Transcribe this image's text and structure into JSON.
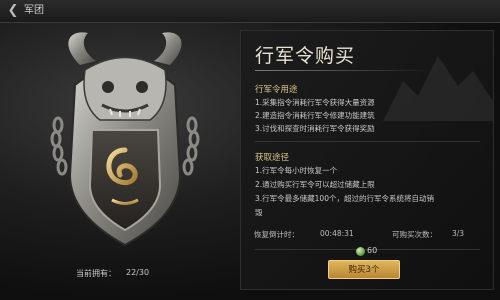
{
  "topbar": {
    "back_icon": "back-arrow-icon",
    "title": "军团"
  },
  "emblem": {
    "icon": "war-token-emblem",
    "held_label": "当前拥有：",
    "held_value": "22/30"
  },
  "panel": {
    "title": "行军令购买",
    "usage": {
      "heading": "行军令用途",
      "lines": [
        "1.采集指令消耗行军令获得大量资源",
        "2.建造指令消耗行军令修建功能建筑",
        "3.讨伐和探查时消耗行军令获得奖励"
      ]
    },
    "obtain": {
      "heading": "获取途径",
      "lines": [
        "1.行军令每小时恢复一个",
        "2.通过购买行军令可以超过储藏上限",
        "3.行军令最多储藏100个，超过的行军令系统将自动销",
        "毁"
      ]
    },
    "recover_label": "恢复倒计时：",
    "recover_time": "00:48:31",
    "buyable_label": "可购买次数：",
    "buyable_value": "3/3",
    "cost_icon": "jade-currency-icon",
    "cost_value": "60",
    "buy_button": "购买3个"
  },
  "colors": {
    "accent_gold": "#d8c48a",
    "button_gold": "#c99a44"
  }
}
